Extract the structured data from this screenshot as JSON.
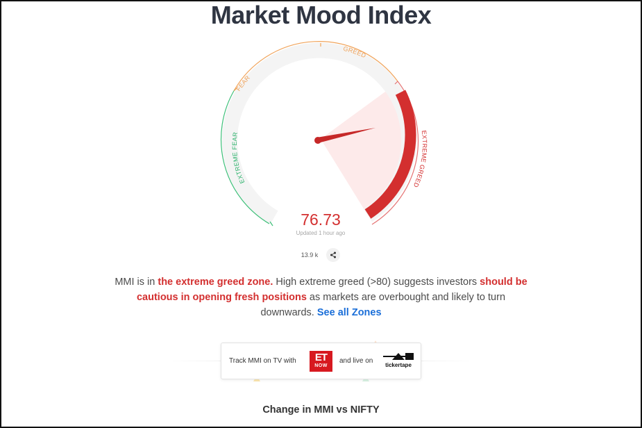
{
  "header": {
    "title": "Market Mood Index"
  },
  "gauge": {
    "value": "76.73",
    "updated": "Updated 1 hour ago",
    "zones": {
      "extreme_fear": "EXTREME FEAR",
      "fear": "FEAR",
      "greed": "GREED",
      "extreme_greed": "EXTREME GREED"
    },
    "colors": {
      "extreme_fear": "#2fb36d",
      "fear": "#f0a35a",
      "greed": "#f0a35a",
      "extreme_greed": "#d32f2f",
      "track": "#f5f5f5",
      "needle": "#c62828"
    }
  },
  "social": {
    "views": "13.9 k",
    "share_icon": "share-icon"
  },
  "description": {
    "part1": "MMI is in ",
    "highlight1": "the extreme greed zone.",
    "part2": " High extreme greed (>80) suggests investors ",
    "highlight2": "should be cautious in opening fresh positions",
    "part3": " as markets are overbought and likely to turn downwards. ",
    "link": "See all Zones"
  },
  "track": {
    "prefix": "Track MMI on TV with",
    "et_logo": "ET",
    "et_logo_sub": "NOW",
    "middle": "and live on",
    "tickertape": "tickertape"
  },
  "section": {
    "title": "Change in MMI vs NIFTY"
  }
}
